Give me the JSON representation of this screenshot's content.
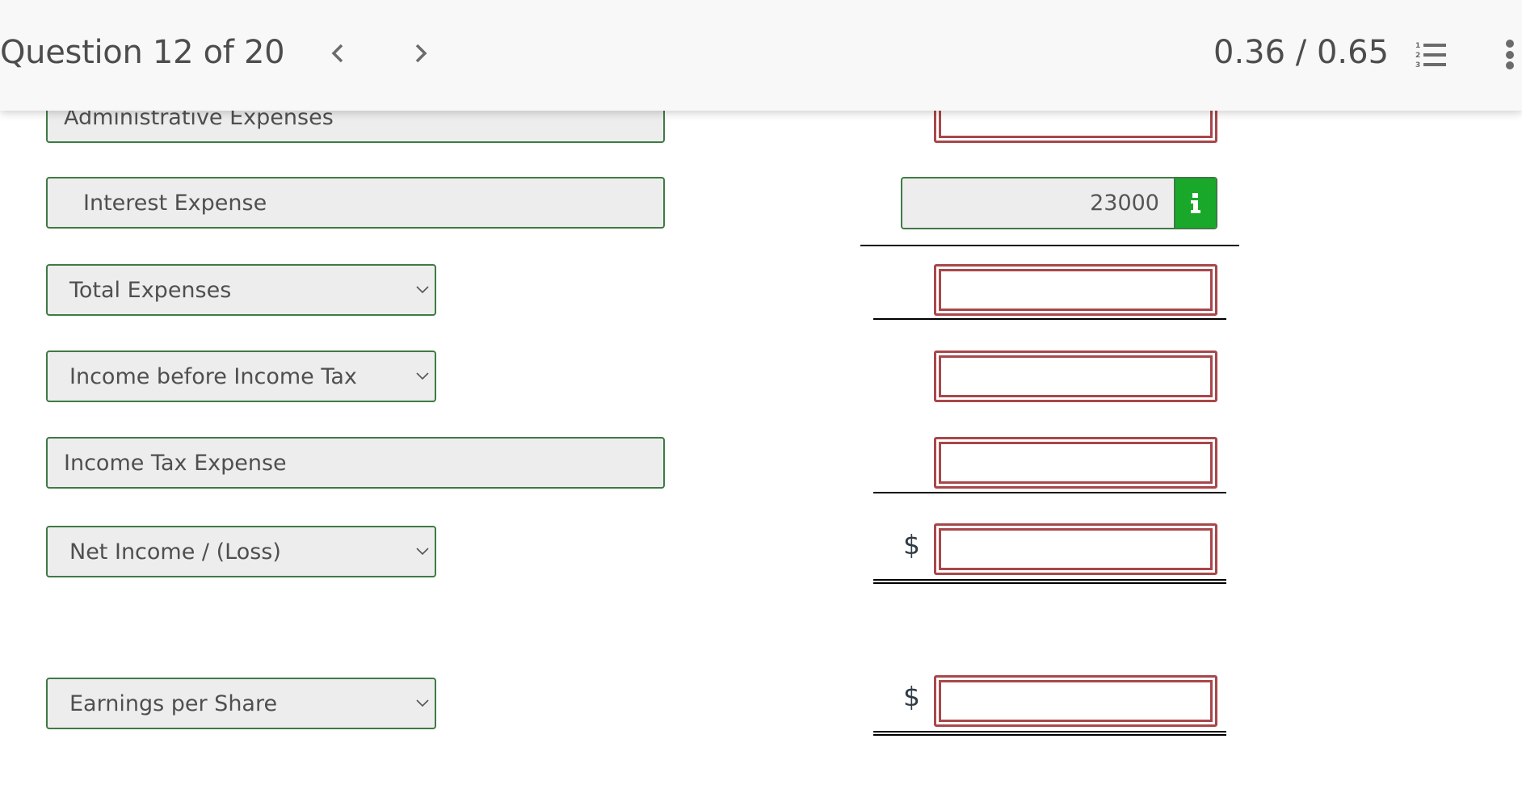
{
  "header": {
    "question_title": "Question 12 of 20",
    "prev_icon": "chevron-left-icon",
    "next_icon": "chevron-right-icon",
    "score": "0.36 / 0.65",
    "list_icon": "numbered-list-icon",
    "more_icon": "more-vertical-icon"
  },
  "statement": {
    "rows": [
      {
        "label": "Administrative Expenses",
        "type": "static-label",
        "amount": "",
        "amount_state": "incorrect"
      },
      {
        "label": "Interest Expense",
        "type": "static-label",
        "amount": "23000",
        "amount_state": "correct",
        "info_icon": "info-icon"
      },
      {
        "label": "Total Expenses",
        "type": "select",
        "amount": "",
        "amount_state": "incorrect"
      },
      {
        "label": "Income before Income Tax",
        "type": "select",
        "amount": "",
        "amount_state": "incorrect"
      },
      {
        "label": "Income Tax Expense",
        "type": "static-label",
        "amount": "",
        "amount_state": "incorrect"
      },
      {
        "label": "Net Income / (Loss)",
        "type": "select",
        "currency": "$",
        "amount": "",
        "amount_state": "incorrect"
      },
      {
        "label": "Earnings per Share",
        "type": "select",
        "currency": "$",
        "amount": "",
        "amount_state": "incorrect"
      }
    ]
  },
  "colors": {
    "correct_border": "#3f7a45",
    "incorrect_border": "#a8474a",
    "info_button": "#1aa82a",
    "field_bg": "#ededed",
    "header_bg": "#f8f8f8"
  }
}
